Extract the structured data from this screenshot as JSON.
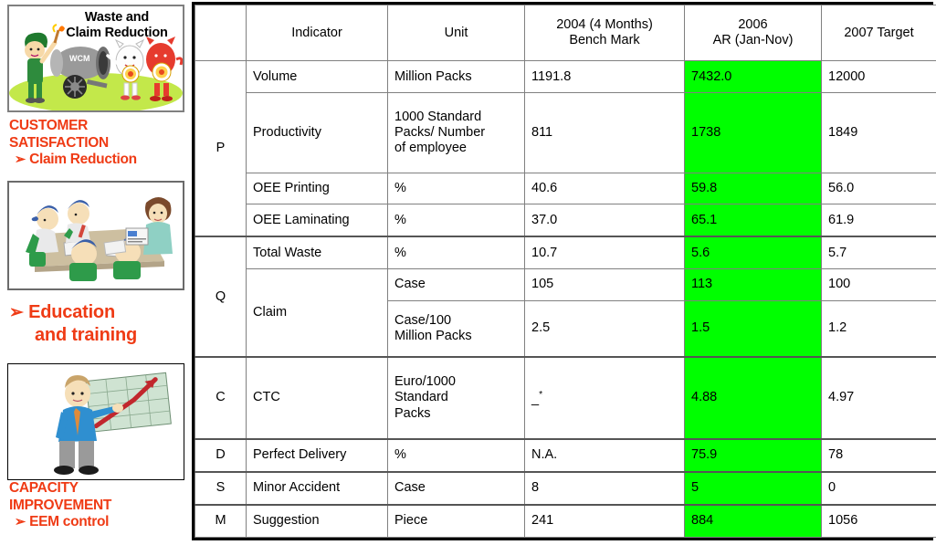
{
  "left_panel": {
    "picture_1": {
      "caption": "Waste and\nClaim Reduction",
      "caption_line1": "Waste and",
      "caption_line2": "Claim Reduction",
      "icon": "wcm-cannon-illustration"
    },
    "text_block_1": {
      "line1": "CUSTOMER",
      "line2": "SATISFACTION",
      "bullet": "➢",
      "line3": "Claim Reduction",
      "color": "#ef3b15"
    },
    "picture_2": {
      "icon": "team-training-illustration"
    },
    "text_block_2": {
      "bullet": "➢",
      "line1": "Education",
      "line2": "and training",
      "color": "#ef3b15"
    },
    "picture_3": {
      "icon": "presenter-growth-chart-illustration"
    },
    "text_block_3": {
      "line1": "CAPACITY",
      "line2": "IMPROVEMENT",
      "bullet": "➢",
      "line3": "EEM control",
      "color": "#ef3b15"
    }
  },
  "table": {
    "highlight_color": "#00ff00",
    "headers": {
      "category": "",
      "indicator": "Indicator",
      "unit": "Unit",
      "benchmark_line1": "2004 (4 Months)",
      "benchmark_line2": "Bench Mark",
      "ar_line1": "2006",
      "ar_line2": "AR (Jan-Nov)",
      "target": "2007 Target"
    },
    "rows": [
      {
        "category": "P",
        "category_rowspan": 4,
        "indicator": "Volume",
        "unit": "Million Packs",
        "benchmark": "1191.8",
        "ar": "7432.0",
        "target": "12000"
      },
      {
        "category": "",
        "indicator": "Productivity",
        "unit": "1000 Standard Packs/ Number of employee",
        "unit_line1": "1000 Standard",
        "unit_line2": "Packs/ Number",
        "unit_line3": "of employee",
        "benchmark": "811",
        "ar": "1738",
        "target": "1849"
      },
      {
        "category": "",
        "indicator": "OEE Printing",
        "unit": "%",
        "benchmark": "40.6",
        "ar": "59.8",
        "target": "56.0"
      },
      {
        "category": "",
        "indicator": "OEE Laminating",
        "unit": "%",
        "benchmark": "37.0",
        "ar": "65.1",
        "target": "61.9"
      },
      {
        "category": "Q",
        "category_rowspan": 3,
        "indicator": "Total Waste",
        "unit": "%",
        "benchmark": "10.7",
        "ar": "5.6",
        "target": "5.7"
      },
      {
        "category": "",
        "indicator": "Claim",
        "indicator_rowspan": 2,
        "unit": "Case",
        "benchmark": "105",
        "ar": "113",
        "target": "100"
      },
      {
        "category": "",
        "indicator": "",
        "unit": "Case/100 Million Packs",
        "unit_line1": "Case/100",
        "unit_line2": "Million Packs",
        "benchmark": "2.5",
        "ar": "1.5",
        "target": "1.2"
      },
      {
        "category": "C",
        "indicator": "CTC",
        "unit": "Euro/1000 Standard Packs",
        "unit_line1": "Euro/1000",
        "unit_line2": "Standard",
        "unit_line3": "Packs",
        "benchmark": "_",
        "benchmark_superscript": "*",
        "ar": "4.88",
        "target": "4.97"
      },
      {
        "category": "D",
        "indicator": "Perfect Delivery",
        "unit": "%",
        "benchmark": "N.A.",
        "ar": "75.9",
        "target": "78"
      },
      {
        "category": "S",
        "indicator": "Minor Accident",
        "unit": "Case",
        "benchmark": "8",
        "ar": "5",
        "target": "0"
      },
      {
        "category": "M",
        "indicator": "Suggestion",
        "unit": "Piece",
        "benchmark": "241",
        "ar": "884",
        "target": "1056"
      }
    ]
  }
}
